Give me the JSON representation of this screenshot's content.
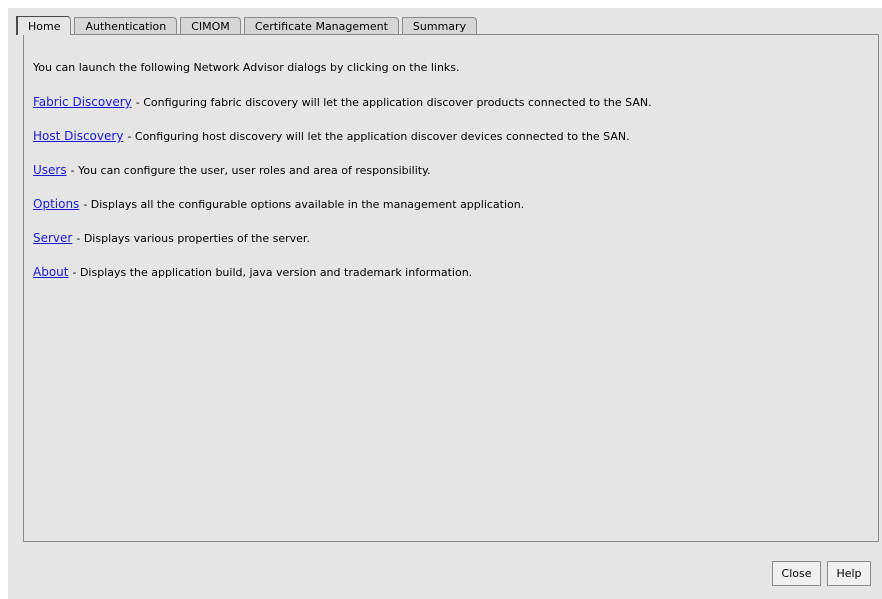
{
  "tabs": [
    "Home",
    "Authentication",
    "CIMOM",
    "Certificate Management",
    "Summary"
  ],
  "active_tab": "Home",
  "home": {
    "intro": "You can launch the following Network Advisor dialogs by clicking on the links.",
    "links": [
      {
        "label": "Fabric Discovery",
        "desc": "- Configuring fabric discovery will let the application discover products connected to the SAN."
      },
      {
        "label": "Host Discovery",
        "desc": "- Configuring host discovery will let the application discover devices connected to the SAN."
      },
      {
        "label": "Users",
        "desc": "- You can configure the user, user roles and area of responsibility."
      },
      {
        "label": "Options",
        "desc": "- Displays all the configurable options available in the management application."
      },
      {
        "label": "Server",
        "desc": "- Displays various properties of the server."
      },
      {
        "label": "About",
        "desc": "- Displays the application build, java version and trademark information."
      }
    ]
  },
  "buttons": {
    "close": "Close",
    "help": "Help"
  }
}
